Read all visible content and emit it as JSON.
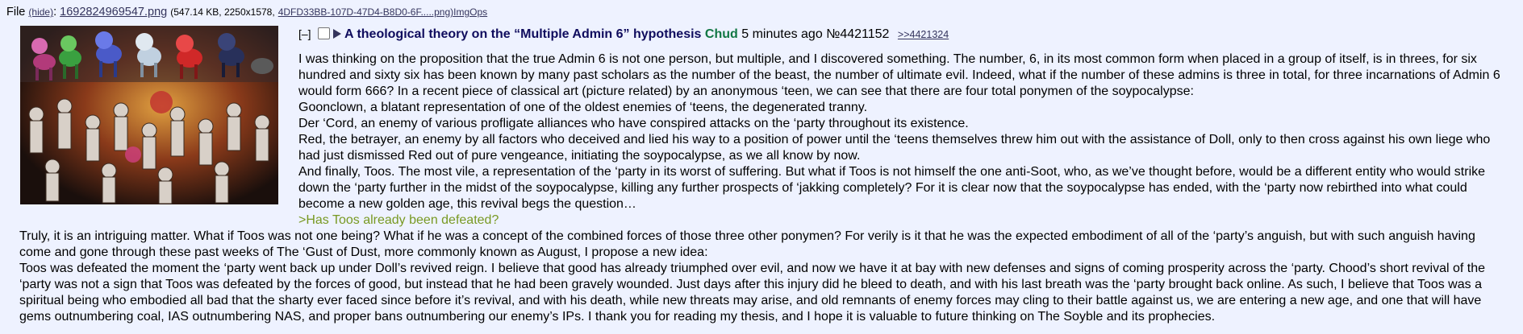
{
  "file": {
    "prefix": "File",
    "hide_label": "(hide)",
    "filename": "1692824969547.png",
    "meta": "(547.14 KB, 2250x1578,",
    "original_name": "4DFD33BB-107D-47D4-B8D0-6F.....png)",
    "imgops": "ImgOps"
  },
  "post": {
    "bracket": "[–]",
    "subject": "A theological theory on the “Multiple Admin 6” hypothesis",
    "name": "Chud",
    "time": "5 minutes ago",
    "number": "№4421152",
    "backlink": ">>4421324"
  },
  "body": {
    "p1": "I was thinking on the proposition that the true Admin 6 is not one person, but multiple, and I discovered something. The number, 6, in its most common form when placed in a group of itself, is in threes, for six hundred and sixty six has been known by many past scholars as the number of the beast, the number of ultimate evil. Indeed, what if the number of these admins is three in total, for three incarnations of Admin 6 would form 666? In a recent piece of classical art (picture related) by an anonymous ‘teen, we can see that there are four total ponymen of the soypocalypse:",
    "p2": "Goonclown, a blatant representation of one of the oldest enemies of ‘teens, the degenerated tranny.",
    "p3": "Der ‘Cord, an enemy of various profligate alliances who have conspired attacks on the ‘party throughout its existence.",
    "p4": "Red, the betrayer, an enemy by all factors who deceived and lied his way to a position of power until the ‘teens themselves threw him out with the assistance of Doll, only to then cross against his own liege who had just dismissed Red out of pure vengeance, initiating the soypocalypse, as we all know by now.",
    "p5": "And finally, Toos. The most vile, a representation of the ‘party in its worst of suffering. But what if Toos is not himself the one anti-Soot, who, as we’ve thought before, would be a different entity who would strike down the ‘party further in the midst of the soypocalypse, killing any further prospects of ‘jakking completely? For it is clear now that the soypocalypse has ended, with the ‘party now rebirthed into what could become a new golden age, this revival begs the question…",
    "greentext": ">Has Toos already been defeated?",
    "p6": "Truly, it is an intriguing matter. What if Toos was not one being? What if he was a concept of the combined forces of those three other ponymen? For verily is it that he was the expected embodiment of all of the ‘party’s anguish, but with such anguish having come and gone through these past weeks of The ‘Gust of Dust, more commonly known as August, I propose a new idea:",
    "p7": "Toos was defeated the moment the ‘party went back up under Doll’s revived reign. I believe that good has already triumphed over evil, and now we have it at bay with new defenses and signs of coming prosperity across the ‘party. Chood’s short revival of the ‘party was not a sign that Toos was defeated by the forces of good, but instead that he had been gravely wounded. Just days after this injury did he bleed to death, and with his last breath was the ‘party brought back online. As such, I believe that Toos was a spiritual being who embodied all bad that the sharty ever faced since before it’s revival, and with his death, while new threats may arise, and old remnants of enemy forces may cling to their battle against us, we are entering a new age, and one that will have gems outnumbering coal, IAS outnumbering NAS, and proper bans outnumbering our enemy’s IPs. I thank you for reading my thesis, and I hope it is valuable to future thinking on The Soyble and its prophecies."
  },
  "colors": {
    "background": "#eef2ff",
    "subject": "#0f0c5d",
    "name": "#117743",
    "greentext": "#789922",
    "link": "#34345c"
  }
}
